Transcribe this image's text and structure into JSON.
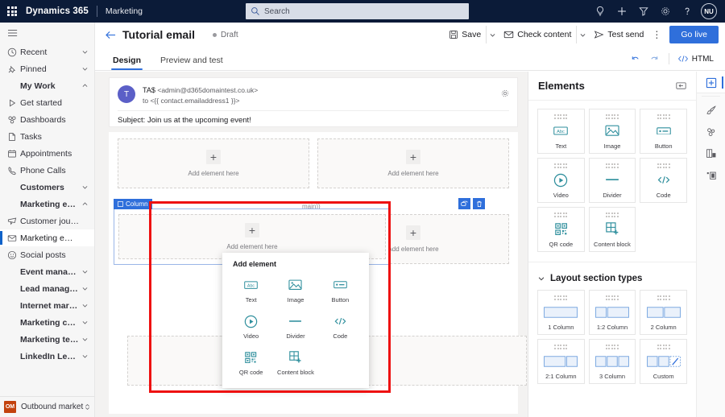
{
  "topbar": {
    "waffle_label": "app-launcher",
    "brand": "Dynamics 365",
    "app_name": "Marketing",
    "search_placeholder": "Search",
    "icons": [
      "lightbulb-icon",
      "plus-icon",
      "filter-icon",
      "gear-icon",
      "question-icon"
    ],
    "avatar_initials": "NU",
    "bg_color": "#0b1b38"
  },
  "sidebar": {
    "items": [
      {
        "label": "Recent",
        "icon": "clock-icon",
        "chevron": "down",
        "group": false
      },
      {
        "label": "Pinned",
        "icon": "pin-icon",
        "chevron": "down",
        "group": false
      },
      {
        "label": "My Work",
        "icon": "",
        "chevron": "up",
        "group": true
      },
      {
        "label": "Get started",
        "icon": "play-icon",
        "chevron": "",
        "group": false
      },
      {
        "label": "Dashboards",
        "icon": "dashboard-icon",
        "chevron": "",
        "group": false
      },
      {
        "label": "Tasks",
        "icon": "task-icon",
        "chevron": "",
        "group": false
      },
      {
        "label": "Appointments",
        "icon": "calendar-icon",
        "chevron": "",
        "group": false
      },
      {
        "label": "Phone Calls",
        "icon": "phone-icon",
        "chevron": "",
        "group": false
      },
      {
        "label": "Customers",
        "icon": "",
        "chevron": "down",
        "group": true
      },
      {
        "label": "Marketing execution",
        "icon": "",
        "chevron": "up",
        "group": true
      },
      {
        "label": "Customer journeys",
        "icon": "journey-icon",
        "chevron": "",
        "group": false
      },
      {
        "label": "Marketing emails",
        "icon": "mail-icon",
        "chevron": "",
        "group": false,
        "selected": true
      },
      {
        "label": "Social posts",
        "icon": "social-icon",
        "chevron": "",
        "group": false
      },
      {
        "label": "Event management",
        "icon": "",
        "chevron": "down",
        "group": true
      },
      {
        "label": "Lead management",
        "icon": "",
        "chevron": "down",
        "group": true
      },
      {
        "label": "Internet marketing",
        "icon": "",
        "chevron": "down",
        "group": true
      },
      {
        "label": "Marketing content",
        "icon": "",
        "chevron": "down",
        "group": true
      },
      {
        "label": "Marketing templates",
        "icon": "",
        "chevron": "down",
        "group": true
      },
      {
        "label": "LinkedIn Lead Gen",
        "icon": "",
        "chevron": "down",
        "group": true
      }
    ],
    "app_switcher": {
      "badge": "OM",
      "label": "Outbound market...",
      "badge_color": "#c3420d"
    }
  },
  "command_bar": {
    "page_title": "Tutorial email",
    "status": "Draft",
    "save_label": "Save",
    "check_content_label": "Check content",
    "test_send_label": "Test send",
    "overflow_label": "⋮",
    "go_live_label": "Go live",
    "go_live_color": "#2f6fdb"
  },
  "tabs": {
    "items": [
      {
        "label": "Design",
        "active": true
      },
      {
        "label": "Preview and test",
        "active": false
      }
    ],
    "undo_label": "undo-icon",
    "redo_label": "redo-icon",
    "html_label": "HTML"
  },
  "email": {
    "avatar_initial": "T",
    "from_name": "TA$",
    "from_address": "<admin@d365domaintest.co.uk>",
    "to_line": "to <{{ contact.emailaddress1 }}>",
    "subject": "Subject: Join us at the upcoming event!",
    "settings_icon": "gear-icon"
  },
  "canvas": {
    "drop_placeholder": "Add element here",
    "plus_label": "+",
    "selected_section": {
      "tag_label": "Column",
      "tag_icon": "column-icon",
      "toolbar": [
        {
          "name": "duplicate-section-button",
          "icon": "copy-icon"
        },
        {
          "name": "delete-section-button",
          "icon": "trash-icon"
        }
      ]
    },
    "footer_fragment": "main))"
  },
  "add_element_popup": {
    "title": "Add element",
    "items": [
      {
        "label": "Text",
        "icon": "text-abc-icon"
      },
      {
        "label": "Image",
        "icon": "image-icon"
      },
      {
        "label": "Button",
        "icon": "button-icon"
      },
      {
        "label": "Video",
        "icon": "video-play-icon"
      },
      {
        "label": "Divider",
        "icon": "divider-icon"
      },
      {
        "label": "Code",
        "icon": "code-icon"
      },
      {
        "label": "QR code",
        "icon": "qr-code-icon"
      },
      {
        "label": "Content block",
        "icon": "content-block-icon"
      }
    ]
  },
  "elements_panel": {
    "title": "Elements",
    "collapse_icon": "collapse-panel-icon",
    "elements": [
      {
        "label": "Text",
        "icon": "text-abc-icon"
      },
      {
        "label": "Image",
        "icon": "image-icon"
      },
      {
        "label": "Button",
        "icon": "button-icon"
      },
      {
        "label": "Video",
        "icon": "video-play-icon"
      },
      {
        "label": "Divider",
        "icon": "divider-icon"
      },
      {
        "label": "Code",
        "icon": "code-icon"
      },
      {
        "label": "QR code",
        "icon": "qr-code-icon"
      },
      {
        "label": "Content block",
        "icon": "content-block-icon"
      }
    ],
    "layout_section_title": "Layout section types",
    "layouts": [
      {
        "label": "1 Column",
        "cols": [
          1
        ]
      },
      {
        "label": "1:2 Column",
        "cols": [
          1,
          2
        ]
      },
      {
        "label": "2 Column",
        "cols": [
          1,
          1
        ]
      },
      {
        "label": "2:1 Column",
        "cols": [
          2,
          1
        ]
      },
      {
        "label": "3 Column",
        "cols": [
          1,
          1,
          1
        ]
      },
      {
        "label": "Custom",
        "cols": [
          1,
          1,
          1
        ],
        "custom": true
      }
    ]
  },
  "right_rail": {
    "buttons": [
      {
        "name": "elements-rail-button",
        "icon": "add-block-icon",
        "active": true
      },
      {
        "name": "styles-rail-button",
        "icon": "brush-icon",
        "active": false
      },
      {
        "name": "personalization-rail-button",
        "icon": "merge-icon",
        "active": false
      },
      {
        "name": "layout-rail-button",
        "icon": "layout-icon",
        "active": false
      },
      {
        "name": "preview-rail-button",
        "icon": "device-preview-icon",
        "active": false
      }
    ]
  },
  "accent": {
    "blue": "#2f6fdb",
    "teal": "#2f8f9d",
    "highlight_red": "#ee1111"
  }
}
